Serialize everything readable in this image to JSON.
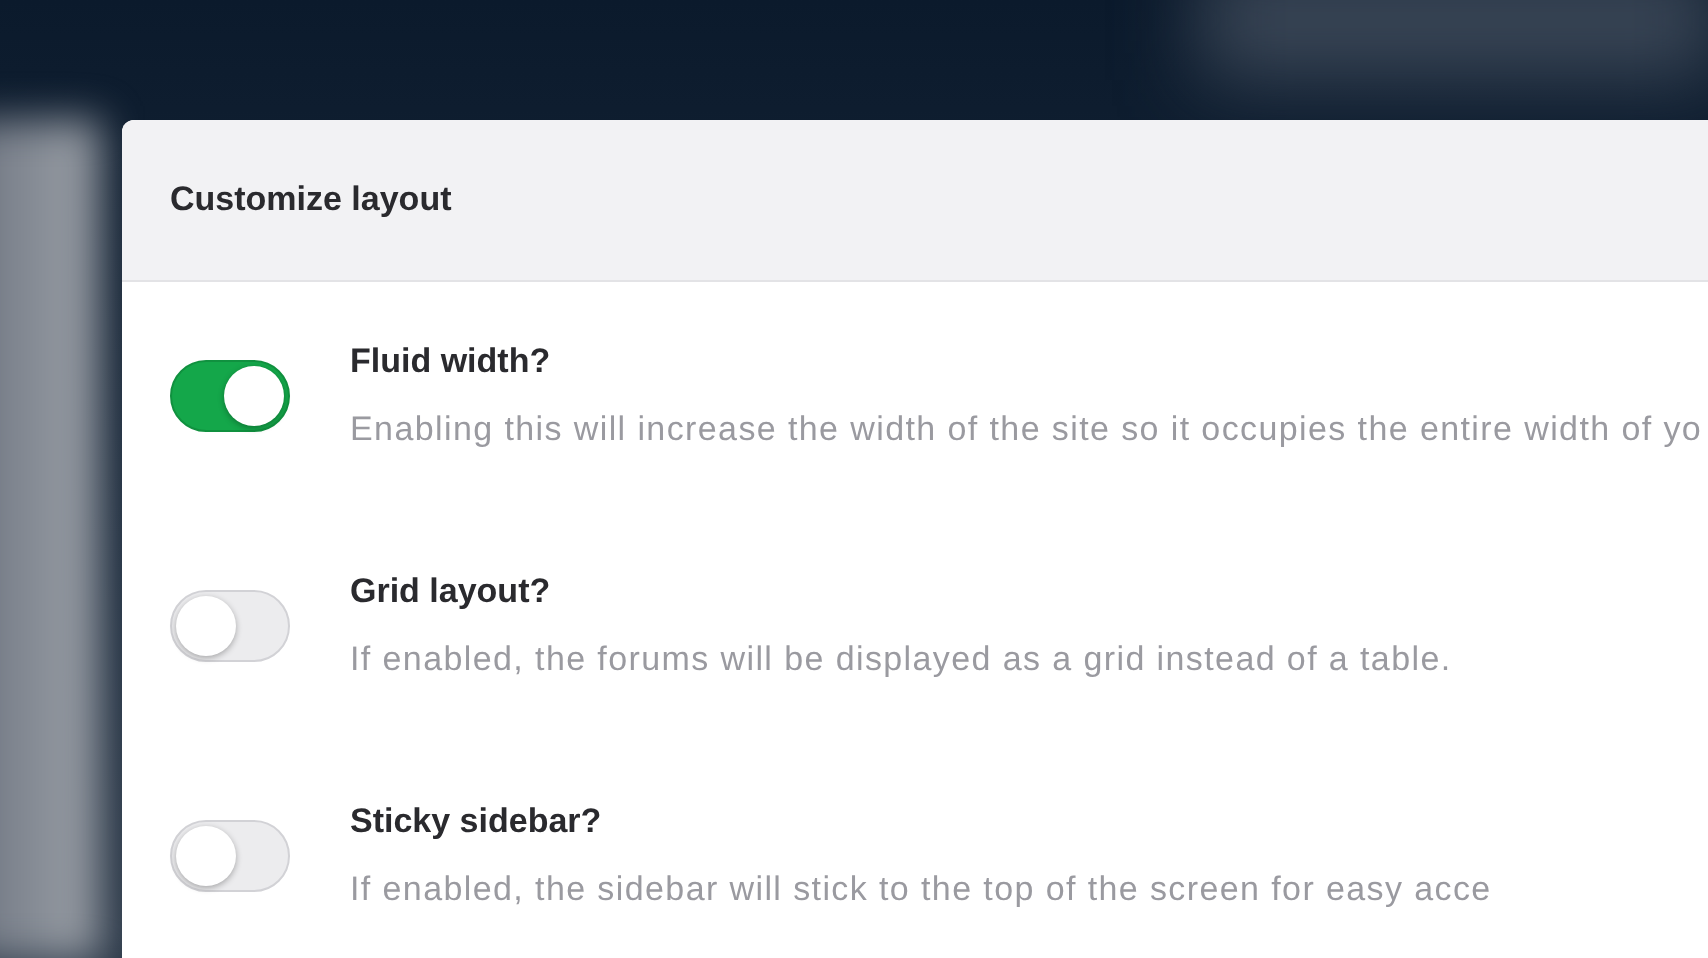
{
  "dialog": {
    "title": "Customize layout"
  },
  "options": [
    {
      "title": "Fluid width?",
      "description": "Enabling this will increase the width of the site so it occupies the entire width of yo",
      "on": true
    },
    {
      "title": "Grid layout?",
      "description": "If enabled, the forums will be displayed as a grid instead of a table.",
      "on": false
    },
    {
      "title": "Sticky sidebar?",
      "description": "If enabled, the sidebar will stick to the top of the screen for easy acce",
      "on": false
    }
  ]
}
